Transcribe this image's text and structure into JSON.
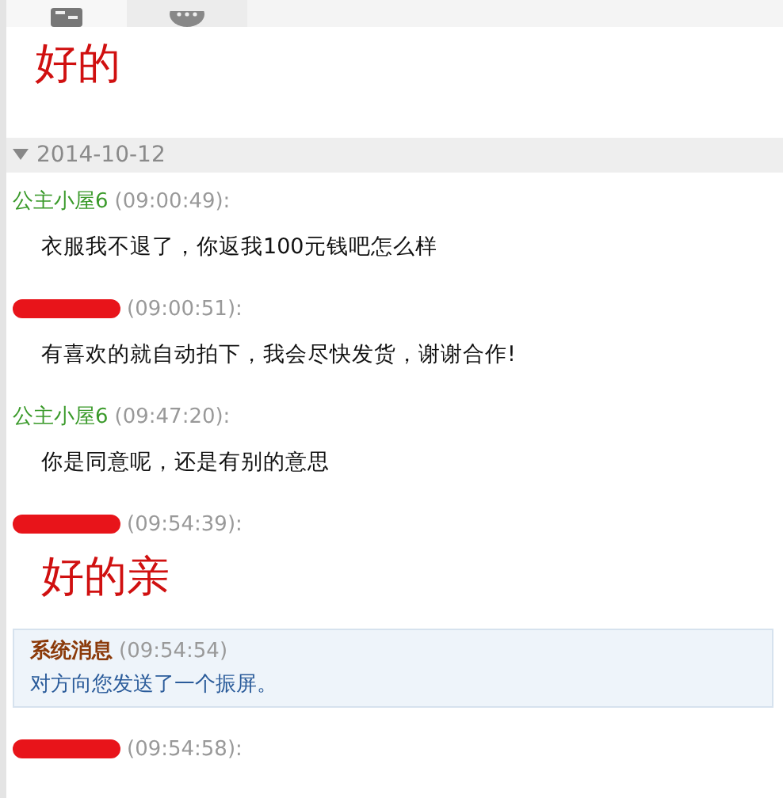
{
  "tabs": [
    {
      "kind": "contact"
    },
    {
      "kind": "chat"
    }
  ],
  "previous_message": {
    "text": "好的",
    "kind": "large"
  },
  "date_group": {
    "date": "2014-10-12",
    "expanded": true
  },
  "messages": [
    {
      "kind": "customer",
      "sender": "公主小屋6",
      "time": "(09:00:49):",
      "text": "衣服我不退了，你返我100元钱吧怎么样"
    },
    {
      "kind": "redacted",
      "time": "(09:00:51):",
      "text": "有喜欢的就自动拍下，我会尽快发货，谢谢合作!"
    },
    {
      "kind": "customer",
      "sender": "公主小屋6",
      "time": "(09:47:20):",
      "text": "你是同意呢，还是有别的意思"
    },
    {
      "kind": "redacted_large",
      "time": "(09:54:39):",
      "text": "好的亲"
    },
    {
      "kind": "system",
      "sender": "系统消息",
      "time": "(09:54:54)",
      "text": "对方向您发送了一个振屏。"
    },
    {
      "kind": "redacted",
      "time": "(09:54:58):"
    }
  ]
}
